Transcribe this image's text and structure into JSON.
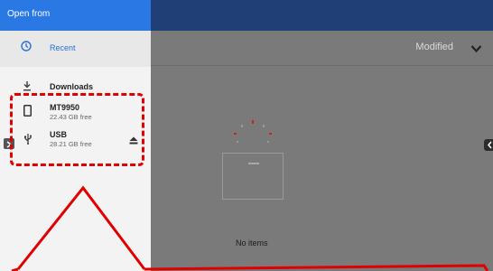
{
  "header": {
    "title": "Open from"
  },
  "drawer": {
    "recent": {
      "label": "Recent",
      "icon": "clock-icon"
    },
    "downloads": {
      "label": "Downloads",
      "icon": "download-icon"
    },
    "devices": [
      {
        "name": "MT9950",
        "free": "22.43 GB free",
        "icon": "phone-icon"
      },
      {
        "name": "USB",
        "free": "28.21 GB free",
        "icon": "usb-icon",
        "eject_icon": "eject-icon"
      }
    ]
  },
  "main": {
    "sort_label": "Modified",
    "sort_icon": "chevron-down-icon",
    "empty_text": "No items"
  },
  "colors": {
    "title_bar": "#2a78e4",
    "app_bar": "#1f3f76",
    "accent": "#2a6fd6",
    "annotation": "#e00000"
  }
}
